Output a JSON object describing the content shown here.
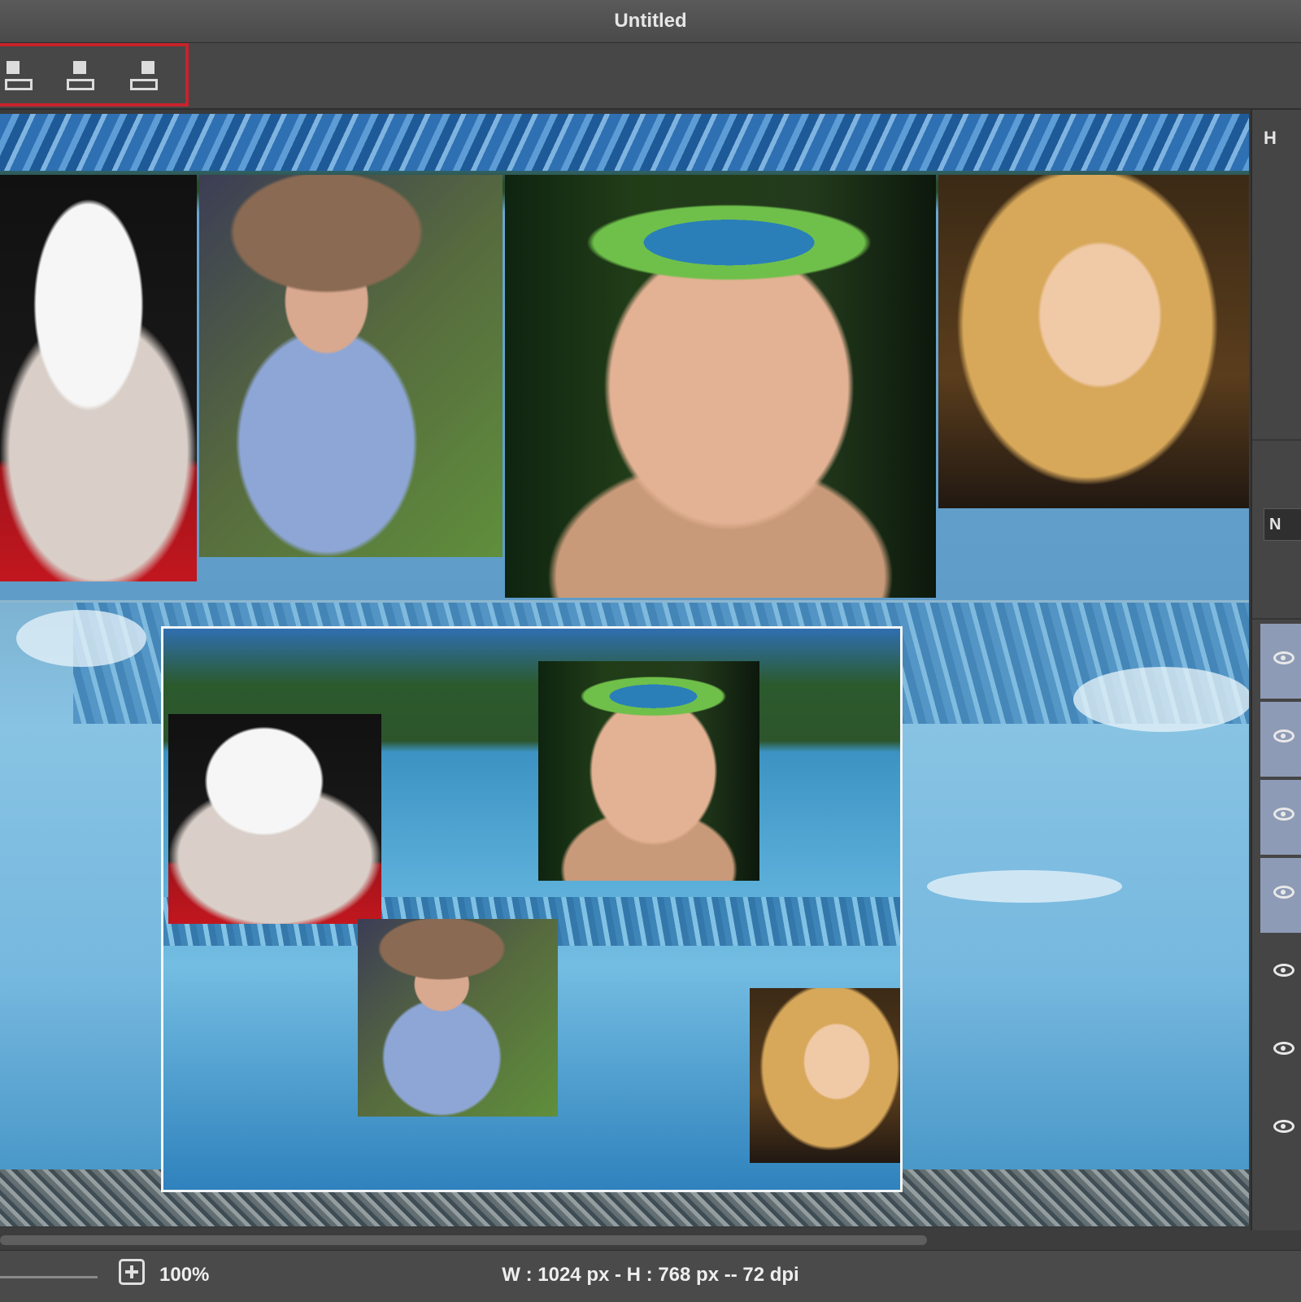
{
  "window": {
    "title": "Untitled"
  },
  "toolbar": {
    "align_group": [
      {
        "icon": "align-left-icon"
      },
      {
        "icon": "align-center-icon"
      },
      {
        "icon": "align-right-icon"
      }
    ],
    "highlight_color": "#c8232c"
  },
  "side_panel": {
    "header": "H",
    "blend_mode": "N",
    "layer_visibility_icons": [
      "eye-icon",
      "eye-icon",
      "eye-icon",
      "eye-icon",
      "eye-icon",
      "eye-icon",
      "eye-icon"
    ],
    "selected_layer_color": "#8e9bb6"
  },
  "status": {
    "zoom": "100%",
    "dimensions": "W : 1024 px  -  H : 768 px  --  72 dpi"
  }
}
